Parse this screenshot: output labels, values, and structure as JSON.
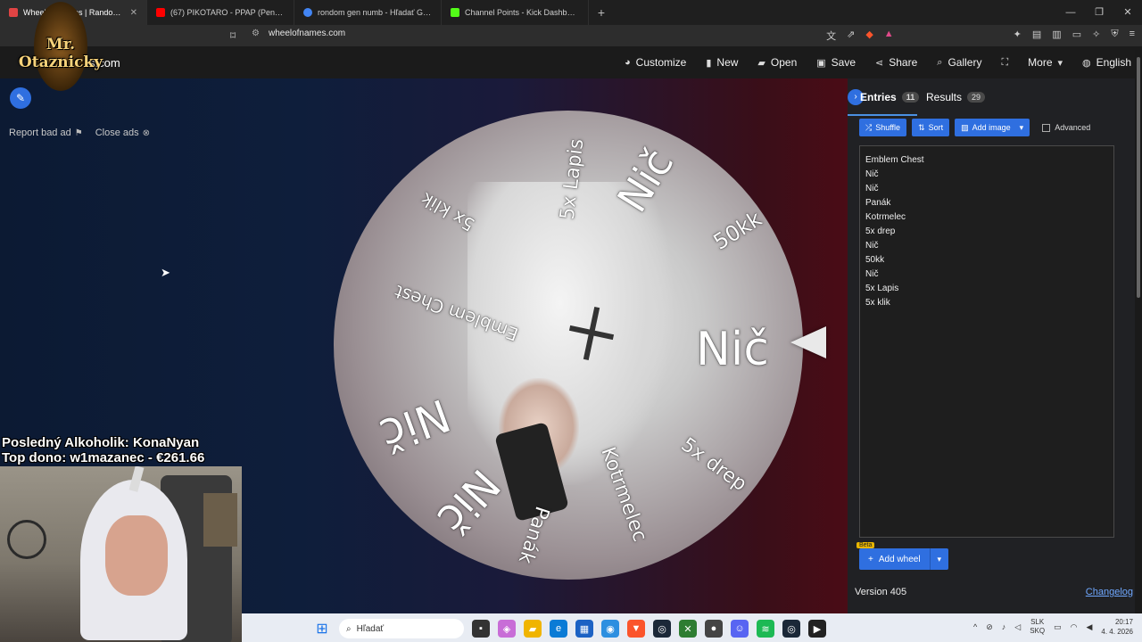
{
  "browser": {
    "tabs": [
      {
        "title": "Wheel of Names | Random na",
        "color": "#e04444",
        "active": true
      },
      {
        "title": "(67) PIKOTARO - PPAP (Pen Pineapple",
        "color": "#ff0000",
        "active": false
      },
      {
        "title": "rondom gen numb - Hľadať Googlom",
        "color": "#4285f4",
        "active": false
      },
      {
        "title": "Channel Points - Kick Dashboard",
        "color": "#53fc18",
        "active": false
      }
    ],
    "new_tab": "+",
    "url": "wheelofnames.com"
  },
  "overlay": {
    "streamer_name": "Mr. Otaznicky",
    "last_alcoholic": "Posledný Alkoholik: KonaNyan",
    "top_donor": "Top dono: w1mazanec - €261.66"
  },
  "app": {
    "logo_suffix": "mes.com",
    "nav": [
      {
        "label": "Customize",
        "icon": "palette-icon",
        "glyph": "🎨"
      },
      {
        "label": "New",
        "icon": "new-file-icon",
        "glyph": "▮"
      },
      {
        "label": "Open",
        "icon": "folder-icon",
        "glyph": "▰"
      },
      {
        "label": "Save",
        "icon": "save-icon",
        "glyph": "▣"
      },
      {
        "label": "Share",
        "icon": "share-icon",
        "glyph": "⋖"
      },
      {
        "label": "Gallery",
        "icon": "search-icon",
        "glyph": "⌕"
      },
      {
        "label": "",
        "icon": "fullscreen-icon",
        "glyph": "⛶"
      },
      {
        "label": "More",
        "icon": "chevron-down-icon",
        "glyph": "▾"
      },
      {
        "label": "English",
        "icon": "globe-icon",
        "glyph": "◍"
      }
    ],
    "report_bad_ad": "Report bad ad",
    "close_ads": "Close ads"
  },
  "wheel": {
    "labels": [
      "Emblem Chest",
      "Nič",
      "Nič",
      "Panák",
      "Kotrmelec",
      "5x drep",
      "Nič",
      "50kk",
      "Nič",
      "5x Lapis",
      "5x klik"
    ]
  },
  "panel": {
    "tab_entries": "Entries",
    "entries_count": "11",
    "tab_results": "Results",
    "results_count": "29",
    "shuffle": "Shuffle",
    "sort": "Sort",
    "add_image": "Add image",
    "advanced": "Advanced",
    "entries": [
      "Emblem Chest",
      "Nič",
      "Nič",
      "Panák",
      "Kotrmelec",
      "5x drep",
      "Nič",
      "50kk",
      "Nič",
      "5x Lapis",
      "5x klik"
    ],
    "beta": "Beta",
    "add_wheel": "Add wheel",
    "version": "Version 405",
    "changelog": "Changelog"
  },
  "taskbar": {
    "search_placeholder": "Hľadať",
    "lang_top": "SLK",
    "lang_bottom": "SKQ",
    "time": "20:17",
    "date": "4. 4. 2026"
  },
  "colors": {
    "accent": "#2f6fe0",
    "link": "#6fa8ff",
    "beta": "#e8b500"
  }
}
